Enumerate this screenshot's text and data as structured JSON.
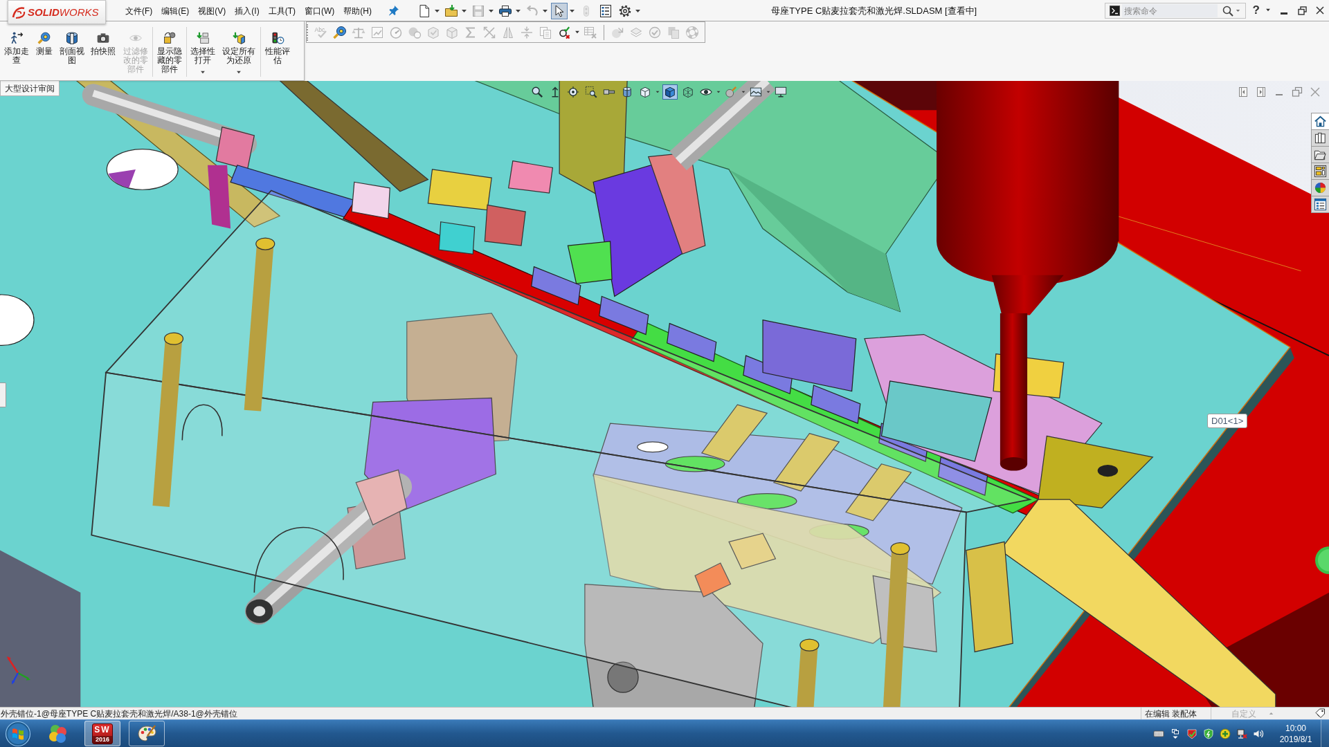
{
  "title_bar": {
    "logo": "**SOLID**WORKS",
    "menus": [
      "文件(F)",
      "编辑(E)",
      "视图(V)",
      "插入(I)",
      "工具(T)",
      "窗口(W)",
      "帮助(H)"
    ],
    "window_title": "母座TYPE C贴麦拉套壳和激光焊.SLDASM [查看中]",
    "search": {
      "placeholder": "搜索命令"
    },
    "help": "?"
  },
  "quick_access": [
    {
      "kind": "new",
      "disabled": false,
      "pressed": false,
      "dropdown": true
    },
    {
      "kind": "open",
      "disabled": false,
      "pressed": false,
      "dropdown": true
    },
    {
      "kind": "save",
      "disabled": true,
      "pressed": false,
      "dropdown": true
    },
    {
      "kind": "print",
      "disabled": false,
      "pressed": false,
      "dropdown": true
    },
    {
      "kind": "undo",
      "disabled": true,
      "pressed": false,
      "dropdown": true
    },
    {
      "kind": "select",
      "disabled": false,
      "pressed": true,
      "dropdown": true
    },
    {
      "kind": "rebuild",
      "disabled": true,
      "pressed": false,
      "dropdown": false
    },
    {
      "kind": "options",
      "disabled": false,
      "pressed": false,
      "dropdown": false
    },
    {
      "kind": "settings",
      "disabled": false,
      "pressed": false,
      "dropdown": true
    }
  ],
  "command_manager": {
    "groups": [
      [
        {
          "kind": "walkthrough",
          "label": "添加走查",
          "disabled": false,
          "dropdown": false
        },
        {
          "kind": "measure",
          "label": "测量",
          "disabled": false,
          "dropdown": false
        },
        {
          "kind": "section",
          "label": "剖面视图",
          "disabled": false,
          "dropdown": false
        },
        {
          "kind": "snapshot",
          "label": "拍快照",
          "disabled": false,
          "dropdown": false
        },
        {
          "kind": "filter",
          "label": "过滤修改的零部件",
          "disabled": true,
          "dropdown": false
        }
      ],
      [
        {
          "kind": "reveal",
          "label": "显示隐藏的零部件",
          "disabled": false,
          "dropdown": false
        }
      ],
      [
        {
          "kind": "selectiveopen",
          "label": "选择性打开",
          "disabled": false,
          "dropdown": true
        },
        {
          "kind": "resolve",
          "label": "设定所有为还原",
          "disabled": false,
          "dropdown": true
        }
      ],
      [
        {
          "kind": "performance",
          "label": "性能评估",
          "disabled": false,
          "dropdown": false
        }
      ]
    ],
    "tabs": [
      {
        "label": "大型设计审阅",
        "selected": true
      }
    ]
  },
  "tools_toolbar": {
    "groups": [
      [
        {
          "kind": "spelling",
          "text": "Abc",
          "disabled": true,
          "dropdown": false
        },
        {
          "kind": "measure",
          "disabled": false,
          "dropdown": false
        },
        {
          "kind": "balance",
          "disabled": true,
          "dropdown": false
        },
        {
          "kind": "chart",
          "disabled": true,
          "dropdown": false
        },
        {
          "kind": "gauge",
          "disabled": true,
          "dropdown": false
        },
        {
          "kind": "mass",
          "disabled": true,
          "dropdown": false
        },
        {
          "kind": "cubecheck",
          "disabled": true,
          "dropdown": false
        },
        {
          "kind": "cube",
          "disabled": true,
          "dropdown": false
        },
        {
          "kind": "sigma",
          "disabled": true,
          "dropdown": false
        },
        {
          "kind": "crossarrows",
          "disabled": true,
          "dropdown": false
        },
        {
          "kind": "mirror",
          "disabled": true,
          "dropdown": false
        },
        {
          "kind": "compress",
          "disabled": true,
          "dropdown": false
        },
        {
          "kind": "documents",
          "disabled": true,
          "dropdown": false
        },
        {
          "kind": "checkcross",
          "disabled": false,
          "dropdown": true
        },
        {
          "kind": "tablecross",
          "disabled": true,
          "dropdown": false
        }
      ],
      [
        {
          "kind": "spherearrow",
          "disabled": true,
          "dropdown": false
        },
        {
          "kind": "layers",
          "disabled": true,
          "dropdown": false
        },
        {
          "kind": "checkcircle",
          "disabled": true,
          "dropdown": false
        },
        {
          "kind": "pages",
          "disabled": true,
          "dropdown": false
        },
        {
          "kind": "lifebuoy",
          "disabled": true,
          "dropdown": false
        }
      ]
    ]
  },
  "viewport": {
    "heads_up": [
      {
        "kind": "zoomfit",
        "pressed": false,
        "dropdown": false
      },
      {
        "kind": "up",
        "pressed": false,
        "dropdown": false
      },
      {
        "kind": "target",
        "pressed": false,
        "dropdown": false
      },
      {
        "kind": "zoombox",
        "pressed": false,
        "dropdown": false
      },
      {
        "kind": "bolt",
        "pressed": false,
        "dropdown": false
      },
      {
        "kind": "section",
        "pressed": false,
        "dropdown": false
      },
      {
        "kind": "orientation",
        "pressed": false,
        "dropdown": true
      },
      {
        "kind": "shaded",
        "pressed": true,
        "dropdown": false
      },
      {
        "kind": "wireframe",
        "pressed": false,
        "dropdown": false
      },
      {
        "kind": "eye",
        "pressed": false,
        "dropdown": true
      },
      {
        "kind": "appearance",
        "pressed": false,
        "dropdown": true
      },
      {
        "kind": "scene",
        "pressed": false,
        "dropdown": true
      },
      {
        "kind": "monitor",
        "pressed": false,
        "dropdown": false
      }
    ],
    "task_pane": [
      {
        "kind": "home",
        "selected": true
      },
      {
        "kind": "library",
        "selected": false
      },
      {
        "kind": "folder",
        "selected": false
      },
      {
        "kind": "palette",
        "selected": false
      },
      {
        "kind": "appearance",
        "selected": false
      },
      {
        "kind": "properties",
        "selected": false
      }
    ],
    "tag": "D01<1>"
  },
  "status_bar": {
    "path": "外壳错位-1@母座TYPE C贴麦拉套壳和激光焊/A38-1@外壳错位",
    "mode": "在编辑 装配体",
    "units": {
      "label": "自定义",
      "disabled": true
    }
  },
  "taskbar": {
    "apps": [
      {
        "kind": "gallery",
        "running": false,
        "selected": false
      },
      {
        "kind": "solidworks",
        "letters": "SW",
        "version": "2016",
        "running": true,
        "selected": true
      },
      {
        "kind": "paint",
        "running": true,
        "selected": false
      }
    ],
    "time": "10:00",
    "date": "2019/8/1"
  }
}
